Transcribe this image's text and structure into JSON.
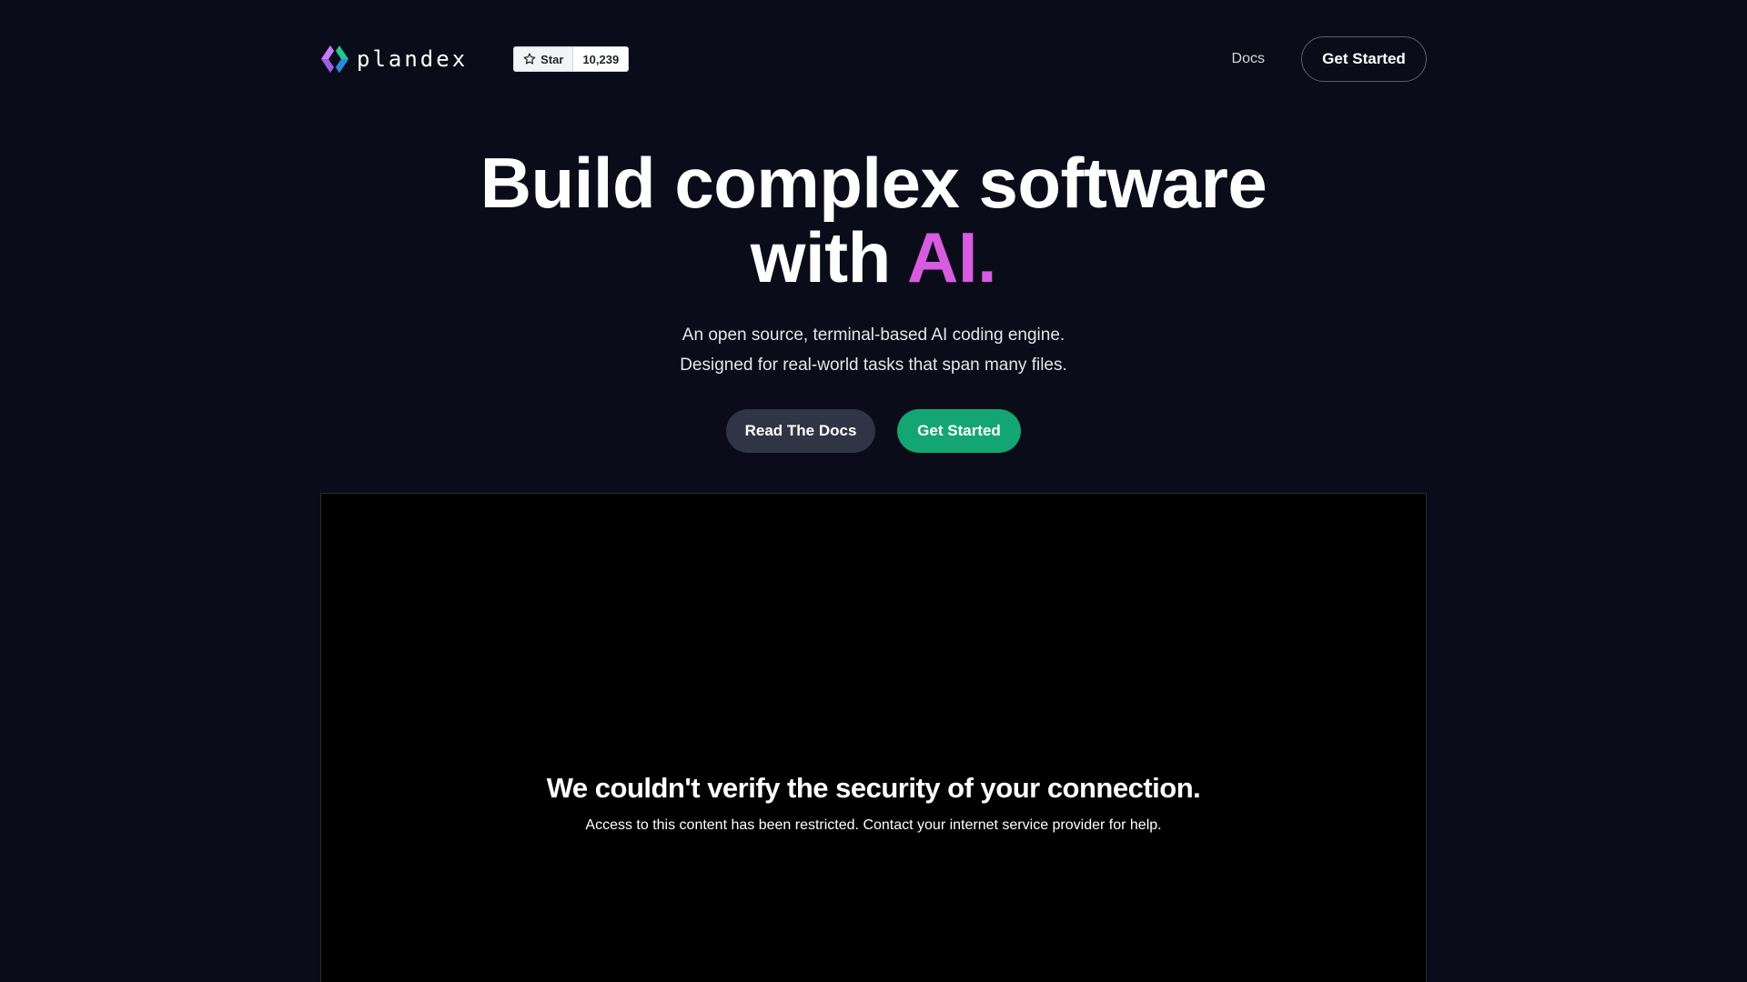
{
  "colors": {
    "background": "#0a0d19",
    "accent_ai": "#d85cdf",
    "primary_button": "#13a672",
    "secondary_button": "#2f3544",
    "frame_background": "#000000"
  },
  "header": {
    "logo_text": "plandex",
    "github_badge": {
      "icon": "star-icon",
      "label": "Star",
      "count": "10,239"
    },
    "nav": {
      "docs_label": "Docs",
      "cta_label": "Get Started"
    }
  },
  "hero": {
    "title_line1": "Build complex software",
    "title_line2_prefix": "with ",
    "title_line2_accent": "AI.",
    "subtitle_line1": "An open source, terminal-based AI coding engine.",
    "subtitle_line2": "Designed for real-world tasks that span many files.",
    "buttons": {
      "docs_label": "Read The Docs",
      "start_label": "Get Started"
    }
  },
  "embed": {
    "title": "We couldn't verify the security of your connection.",
    "message": "Access to this content has been restricted. Contact your internet service provider for help."
  }
}
